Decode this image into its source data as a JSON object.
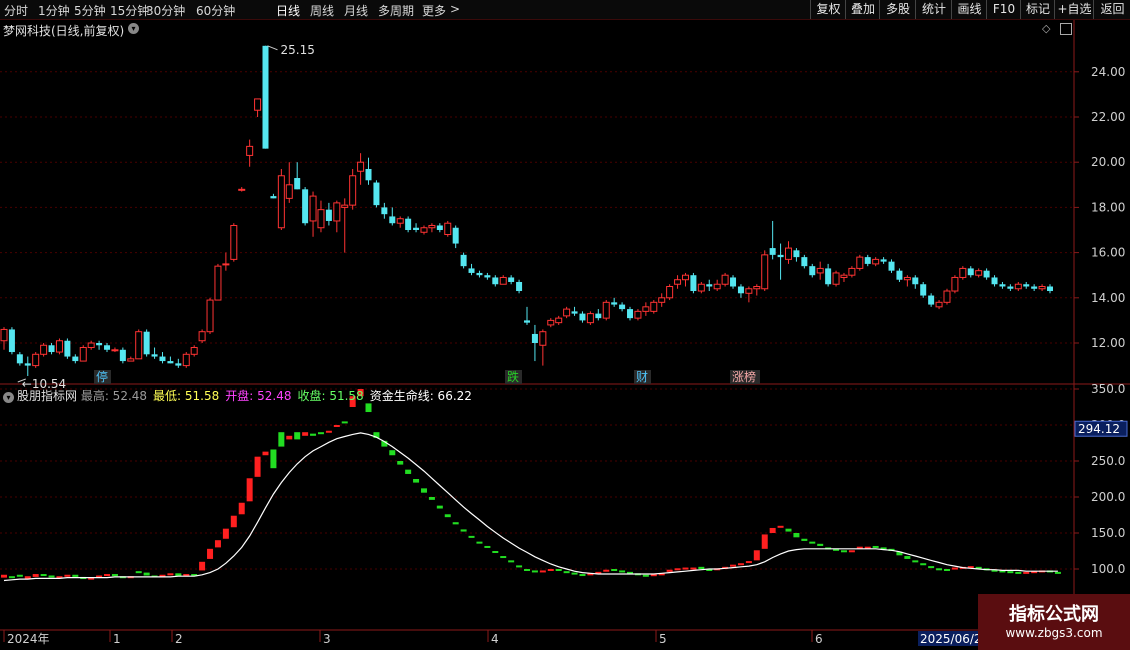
{
  "toolbar": {
    "periods": [
      "分时",
      "1分钟",
      "5分钟",
      "15分钟",
      "30分钟",
      "60分钟",
      "日线",
      "周线",
      "月线",
      "多周期",
      "更多"
    ],
    "active_period": "日线",
    "more_arrow": ">",
    "actions": [
      "复权",
      "叠加",
      "多股",
      "统计",
      "画线",
      "F10",
      "标记",
      "+自选",
      "返回"
    ]
  },
  "main_panel": {
    "title": "梦网科技(日线,前复权)",
    "price_axis": [
      "24.00",
      "22.00",
      "20.00",
      "18.00",
      "16.00",
      "14.00",
      "12.00"
    ],
    "high_label": "25.15",
    "low_label": "10.54",
    "event_tags": [
      {
        "text": "停",
        "color": "#4fc3f7"
      },
      {
        "text": "跌",
        "color": "#28d228"
      },
      {
        "text": "财",
        "color": "#4fc3f7"
      },
      {
        "text": "涨榜",
        "color": "#f2a6a6"
      }
    ]
  },
  "indicator_panel": {
    "name": "股朋指标网",
    "fields": [
      {
        "label": "最高:",
        "value": "52.48",
        "color": "#9a9a9a"
      },
      {
        "label": "最低:",
        "value": "51.58",
        "color": "#ffff55"
      },
      {
        "label": "开盘:",
        "value": "52.48",
        "color": "#ff44ff"
      },
      {
        "label": "收盘:",
        "value": "51.58",
        "color": "#66ff66"
      },
      {
        "label": "资金生命线:",
        "value": "66.22",
        "color": "#ffffff"
      }
    ],
    "axis": [
      "350.0",
      "300.0",
      "250.0",
      "200.0",
      "150.0",
      "100.0"
    ],
    "current_value": "294.12"
  },
  "date_axis": [
    "2024年",
    "1",
    "2",
    "3",
    "4",
    "5",
    "6"
  ],
  "date_cursor": "2025/06/2",
  "watermark": {
    "title": "指标公式网",
    "url": "www.zbgs3.com"
  },
  "colors": {
    "up": "#ff3333",
    "down": "#55e6f0",
    "grid": "#4a0000",
    "border": "#8b1a1a",
    "axis_text": "#d0d0d0",
    "ind_up": "#ff2020",
    "ind_down": "#22dd22",
    "lifeline": "#ffffff"
  },
  "chart_data": {
    "type": "candlestick",
    "price_range": [
      10.0,
      25.8
    ],
    "candles": [
      [
        12.1,
        12.7,
        11.7,
        12.6
      ],
      [
        12.6,
        12.7,
        11.5,
        11.6
      ],
      [
        11.5,
        11.6,
        11.0,
        11.1
      ],
      [
        11.1,
        11.4,
        10.54,
        11.0
      ],
      [
        11.0,
        11.6,
        10.9,
        11.5
      ],
      [
        11.5,
        12.0,
        11.4,
        11.9
      ],
      [
        11.9,
        12.0,
        11.5,
        11.6
      ],
      [
        11.6,
        12.2,
        11.5,
        12.1
      ],
      [
        12.1,
        12.2,
        11.3,
        11.4
      ],
      [
        11.4,
        11.5,
        11.1,
        11.2
      ],
      [
        11.2,
        11.9,
        11.2,
        11.8
      ],
      [
        11.8,
        12.1,
        11.7,
        12.0
      ],
      [
        12.0,
        12.1,
        11.7,
        11.9
      ],
      [
        11.9,
        12.0,
        11.6,
        11.7
      ],
      [
        11.7,
        11.8,
        11.6,
        11.7
      ],
      [
        11.7,
        11.8,
        11.1,
        11.2
      ],
      [
        11.2,
        11.4,
        11.2,
        11.3
      ],
      [
        11.3,
        12.6,
        11.3,
        12.5
      ],
      [
        12.5,
        12.6,
        11.4,
        11.5
      ],
      [
        11.5,
        11.8,
        11.3,
        11.4
      ],
      [
        11.4,
        11.6,
        11.1,
        11.2
      ],
      [
        11.2,
        11.4,
        11.1,
        11.1
      ],
      [
        11.1,
        11.3,
        10.9,
        11.0
      ],
      [
        11.0,
        11.6,
        10.9,
        11.5
      ],
      [
        11.5,
        11.9,
        11.4,
        11.8
      ],
      [
        12.1,
        12.6,
        12.0,
        12.5
      ],
      [
        12.5,
        14.0,
        12.4,
        13.9
      ],
      [
        13.9,
        15.5,
        14.2,
        15.4
      ],
      [
        15.5,
        16.0,
        15.2,
        15.5
      ],
      [
        15.7,
        17.3,
        15.6,
        17.2
      ],
      [
        18.8,
        18.9,
        18.7,
        18.8
      ],
      [
        20.3,
        21.0,
        19.8,
        20.7
      ],
      [
        22.3,
        22.8,
        22.0,
        22.8
      ],
      [
        25.15,
        25.15,
        20.6,
        20.6
      ],
      [
        18.5,
        18.6,
        18.4,
        18.4
      ],
      [
        17.1,
        19.7,
        17.0,
        19.4
      ],
      [
        18.4,
        20.0,
        18.2,
        19.0
      ],
      [
        19.3,
        20.0,
        18.8,
        18.8
      ],
      [
        18.8,
        18.9,
        17.2,
        17.3
      ],
      [
        17.4,
        18.7,
        16.7,
        18.5
      ],
      [
        17.1,
        18.3,
        16.9,
        17.9
      ],
      [
        17.9,
        18.2,
        17.2,
        17.4
      ],
      [
        17.4,
        18.3,
        16.9,
        18.2
      ],
      [
        18.0,
        18.4,
        16.0,
        18.1
      ],
      [
        18.1,
        19.7,
        17.9,
        19.4
      ],
      [
        19.6,
        20.4,
        19.0,
        20.0
      ],
      [
        19.7,
        20.2,
        19.0,
        19.2
      ],
      [
        19.1,
        19.2,
        18.0,
        18.1
      ],
      [
        18.0,
        18.2,
        17.5,
        17.7
      ],
      [
        17.6,
        18.0,
        17.2,
        17.3
      ],
      [
        17.3,
        17.6,
        17.1,
        17.5
      ],
      [
        17.5,
        17.6,
        16.9,
        17.0
      ],
      [
        17.1,
        17.3,
        16.9,
        17.0
      ],
      [
        16.9,
        17.2,
        16.8,
        17.1
      ],
      [
        17.1,
        17.3,
        16.9,
        17.2
      ],
      [
        17.2,
        17.3,
        16.9,
        17.0
      ],
      [
        16.8,
        17.4,
        16.7,
        17.3
      ],
      [
        17.1,
        17.2,
        16.2,
        16.4
      ],
      [
        15.9,
        16.0,
        15.3,
        15.4
      ],
      [
        15.3,
        15.5,
        15.0,
        15.1
      ],
      [
        15.1,
        15.2,
        14.9,
        15.0
      ],
      [
        15.0,
        15.1,
        14.8,
        14.9
      ],
      [
        14.9,
        15.0,
        14.5,
        14.6
      ],
      [
        14.6,
        15.0,
        14.6,
        14.9
      ],
      [
        14.9,
        15.0,
        14.6,
        14.7
      ],
      [
        14.7,
        14.8,
        14.2,
        14.3
      ],
      [
        13.0,
        13.6,
        12.8,
        12.9
      ],
      [
        12.4,
        12.8,
        11.2,
        12.0
      ],
      [
        11.9,
        12.6,
        11.0,
        12.5
      ],
      [
        12.8,
        13.1,
        12.7,
        13.0
      ],
      [
        12.9,
        13.2,
        12.8,
        13.1
      ],
      [
        13.2,
        13.6,
        13.1,
        13.5
      ],
      [
        13.4,
        13.6,
        13.2,
        13.3
      ],
      [
        13.3,
        13.4,
        12.9,
        13.0
      ],
      [
        12.9,
        13.4,
        12.8,
        13.3
      ],
      [
        13.3,
        13.5,
        13.0,
        13.1
      ],
      [
        13.1,
        13.9,
        13.0,
        13.8
      ],
      [
        13.8,
        14.0,
        13.6,
        13.7
      ],
      [
        13.7,
        13.8,
        13.4,
        13.5
      ],
      [
        13.5,
        13.6,
        13.0,
        13.1
      ],
      [
        13.1,
        13.5,
        13.0,
        13.4
      ],
      [
        13.4,
        13.8,
        13.2,
        13.6
      ],
      [
        13.4,
        13.9,
        13.3,
        13.8
      ],
      [
        13.8,
        14.2,
        13.6,
        14.0
      ],
      [
        14.0,
        14.6,
        13.9,
        14.5
      ],
      [
        14.6,
        15.0,
        14.4,
        14.8
      ],
      [
        14.8,
        15.1,
        14.5,
        15.0
      ],
      [
        15.0,
        15.1,
        14.2,
        14.3
      ],
      [
        14.3,
        14.7,
        14.2,
        14.6
      ],
      [
        14.6,
        14.8,
        14.3,
        14.5
      ],
      [
        14.4,
        14.8,
        14.3,
        14.6
      ],
      [
        14.6,
        15.1,
        14.5,
        15.0
      ],
      [
        14.9,
        15.0,
        14.4,
        14.5
      ],
      [
        14.5,
        14.6,
        14.0,
        14.2
      ],
      [
        14.2,
        14.5,
        13.8,
        14.4
      ],
      [
        14.4,
        14.6,
        14.1,
        14.5
      ],
      [
        14.4,
        16.1,
        14.3,
        15.9
      ],
      [
        16.2,
        17.4,
        15.7,
        15.9
      ],
      [
        15.9,
        16.4,
        14.8,
        15.8
      ],
      [
        15.7,
        16.5,
        15.5,
        16.2
      ],
      [
        16.1,
        16.2,
        15.6,
        15.8
      ],
      [
        15.8,
        15.9,
        15.3,
        15.4
      ],
      [
        15.4,
        15.5,
        14.9,
        15.0
      ],
      [
        15.1,
        15.6,
        14.8,
        15.3
      ],
      [
        15.3,
        15.5,
        14.5,
        14.6
      ],
      [
        14.6,
        15.2,
        14.5,
        15.1
      ],
      [
        14.9,
        15.1,
        14.7,
        15.0
      ],
      [
        15.0,
        15.4,
        14.9,
        15.3
      ],
      [
        15.3,
        15.9,
        15.2,
        15.8
      ],
      [
        15.8,
        15.9,
        15.4,
        15.5
      ],
      [
        15.5,
        15.8,
        15.4,
        15.7
      ],
      [
        15.7,
        15.8,
        15.5,
        15.6
      ],
      [
        15.6,
        15.7,
        15.1,
        15.2
      ],
      [
        15.2,
        15.3,
        14.7,
        14.8
      ],
      [
        14.8,
        15.0,
        14.5,
        14.9
      ],
      [
        14.9,
        15.0,
        14.4,
        14.6
      ],
      [
        14.6,
        14.7,
        14.0,
        14.1
      ],
      [
        14.1,
        14.2,
        13.6,
        13.7
      ],
      [
        13.6,
        13.9,
        13.5,
        13.8
      ],
      [
        13.8,
        14.4,
        13.7,
        14.3
      ],
      [
        14.3,
        15.0,
        14.2,
        14.9
      ],
      [
        14.9,
        15.4,
        14.8,
        15.3
      ],
      [
        15.3,
        15.4,
        14.9,
        15.0
      ],
      [
        15.0,
        15.3,
        14.9,
        15.2
      ],
      [
        15.2,
        15.3,
        14.8,
        14.9
      ],
      [
        14.9,
        15.0,
        14.5,
        14.6
      ],
      [
        14.6,
        14.7,
        14.4,
        14.5
      ],
      [
        14.5,
        14.6,
        14.3,
        14.4
      ],
      [
        14.4,
        14.7,
        14.3,
        14.6
      ],
      [
        14.6,
        14.7,
        14.4,
        14.5
      ],
      [
        14.5,
        14.6,
        14.3,
        14.4
      ],
      [
        14.4,
        14.6,
        14.3,
        14.5
      ],
      [
        14.5,
        14.6,
        14.2,
        14.3
      ]
    ],
    "indicator": {
      "range": [
        75,
        380
      ],
      "candles_open": [
        88,
        90,
        92,
        86,
        89,
        93,
        91,
        87,
        90,
        92,
        89,
        86,
        88,
        91,
        93,
        90,
        88,
        97,
        95,
        91,
        89,
        92,
        94,
        90,
        93,
        98,
        114,
        130,
        142,
        158,
        176,
        194,
        228,
        258,
        266,
        290,
        280,
        290,
        285,
        288,
        290,
        292,
        300,
        305,
        325,
        340,
        330,
        290,
        278,
        265,
        250,
        238,
        225,
        212,
        200,
        188,
        176,
        165,
        155,
        146,
        138,
        132,
        125,
        118,
        112,
        105,
        100,
        98,
        96,
        98,
        100,
        97,
        95,
        93,
        92,
        94,
        97,
        100,
        98,
        96,
        94,
        92,
        90,
        92,
        96,
        100,
        102,
        101,
        103,
        100,
        99,
        102,
        104,
        107,
        110,
        112,
        128,
        150,
        158,
        156,
        150,
        142,
        138,
        135,
        130,
        128,
        126,
        124,
        128,
        130,
        132,
        130,
        128,
        124,
        118,
        112,
        108,
        104,
        101,
        100,
        100,
        101,
        104,
        103,
        101,
        99,
        98,
        97,
        96,
        95,
        96,
        97,
        98,
        96
      ],
      "candles_close": [
        92,
        88,
        90,
        90,
        93,
        91,
        89,
        90,
        92,
        89,
        86,
        88,
        91,
        93,
        90,
        88,
        90,
        95,
        91,
        89,
        92,
        94,
        90,
        93,
        90,
        110,
        128,
        140,
        156,
        174,
        192,
        226,
        256,
        263,
        240,
        270,
        285,
        280,
        290,
        285,
        288,
        292,
        300,
        303,
        340,
        350,
        318,
        282,
        270,
        258,
        245,
        232,
        220,
        206,
        196,
        184,
        172,
        162,
        152,
        144,
        136,
        130,
        123,
        116,
        110,
        104,
        98,
        97,
        98,
        100,
        98,
        96,
        94,
        92,
        94,
        96,
        99,
        98,
        97,
        95,
        93,
        91,
        93,
        94,
        99,
        101,
        102,
        102,
        100,
        98,
        101,
        103,
        106,
        108,
        111,
        126,
        148,
        157,
        160,
        152,
        144,
        139,
        136,
        132,
        129,
        127,
        125,
        126,
        131,
        131,
        131,
        129,
        125,
        119,
        114,
        110,
        106,
        102,
        100,
        99,
        102,
        103,
        104,
        102,
        100,
        98,
        97,
        96,
        95,
        96,
        97,
        98,
        97,
        95
      ],
      "lifeline": [
        84,
        85,
        86,
        86,
        87,
        87,
        87,
        87,
        88,
        88,
        88,
        88,
        88,
        88,
        89,
        89,
        89,
        89,
        89,
        89,
        89,
        89,
        90,
        90,
        90,
        92,
        95,
        100,
        108,
        118,
        130,
        146,
        165,
        185,
        204,
        220,
        234,
        246,
        256,
        264,
        270,
        276,
        281,
        284,
        287,
        289,
        287,
        283,
        277,
        270,
        262,
        254,
        245,
        236,
        226,
        216,
        206,
        196,
        186,
        177,
        168,
        159,
        151,
        143,
        136,
        129,
        123,
        117,
        112,
        107,
        103,
        100,
        97,
        95,
        94,
        93,
        93,
        93,
        93,
        93,
        93,
        93,
        93,
        94,
        95,
        96,
        97,
        98,
        99,
        100,
        100,
        101,
        102,
        103,
        104,
        106,
        110,
        116,
        121,
        125,
        127,
        128,
        128,
        128,
        128,
        128,
        128,
        128,
        128,
        128,
        128,
        127,
        126,
        124,
        121,
        118,
        115,
        112,
        109,
        106,
        104,
        102,
        101,
        100,
        99,
        99,
        98,
        98,
        98,
        97,
        97,
        97,
        97,
        97
      ]
    }
  }
}
